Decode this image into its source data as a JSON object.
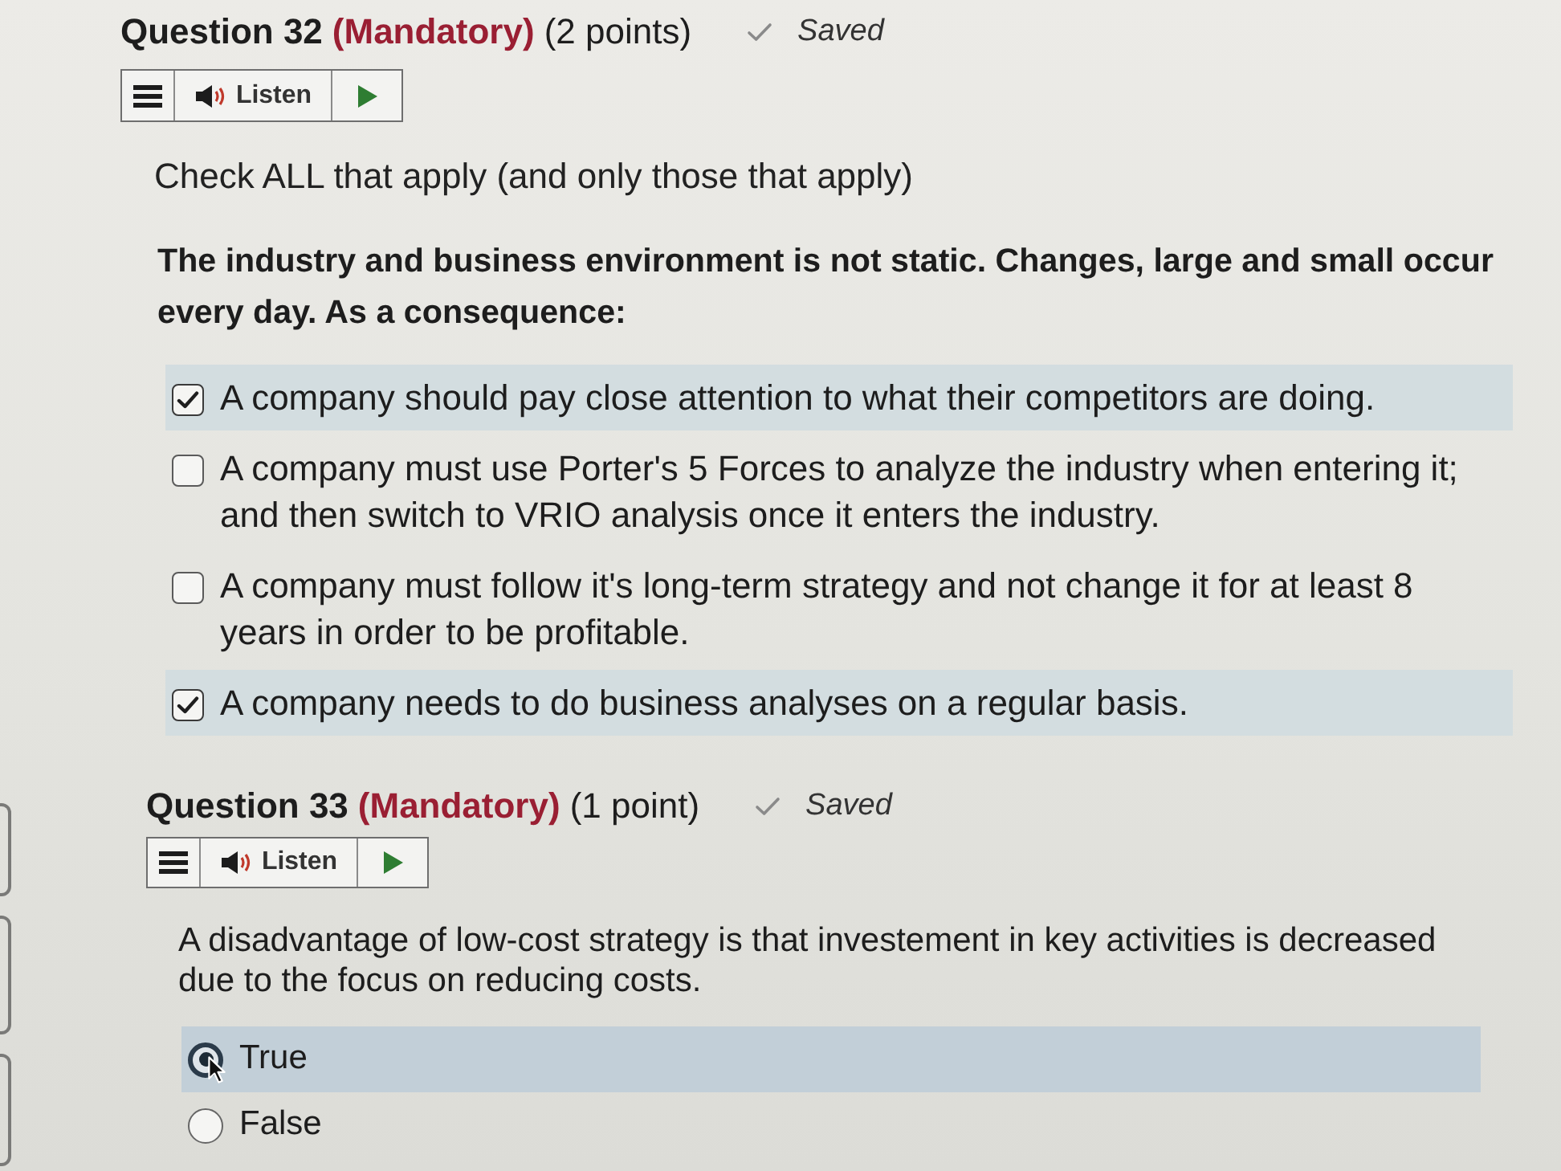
{
  "questions": [
    {
      "title": "Question 32",
      "mandatory": "(Mandatory)",
      "points": "(2 points)",
      "status": "Saved",
      "listen": "Listen",
      "instruction": "Check ALL that apply (and only those that apply)",
      "prompt": {
        "text": "The industry and business environment is not static. Changes, large and small occur every day. As a consequence:",
        "bold": true
      },
      "kind": "checkbox",
      "options": [
        {
          "text": "A company should pay close attention to what their competitors are doing.",
          "checked": true
        },
        {
          "text": "A company must use Porter's 5 Forces to analyze the industry when entering it; and then switch to VRIO analysis once it enters the industry.",
          "checked": false
        },
        {
          "text": "A company must follow it's long-term strategy and not change it for at least 8 years in order to be profitable.",
          "checked": false
        },
        {
          "text": "A company needs to do business analyses on a regular basis.",
          "checked": true
        }
      ]
    },
    {
      "title": "Question 33",
      "mandatory": "(Mandatory)",
      "points": "(1 point)",
      "status": "Saved",
      "listen": "Listen",
      "prompt": {
        "text": "A disadvantage of low-cost strategy is that investement in key activities is decreased due to the focus on reducing costs.",
        "bold": false
      },
      "kind": "radio",
      "options": [
        {
          "text": "True",
          "selected": true,
          "hovered": true
        },
        {
          "text": "False",
          "selected": false,
          "hovered": false
        }
      ]
    }
  ]
}
